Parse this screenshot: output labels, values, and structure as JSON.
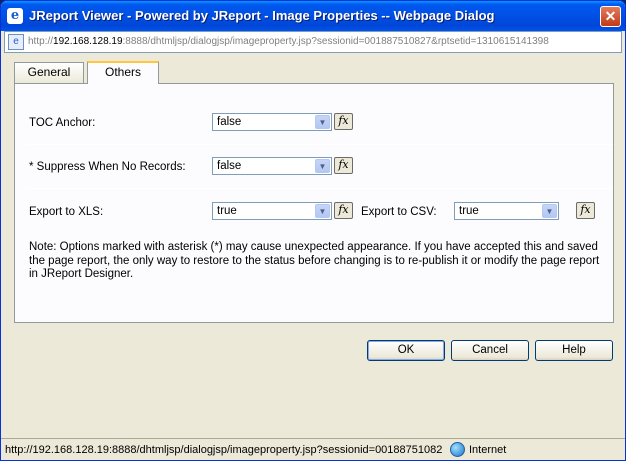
{
  "window": {
    "title": "JReport Viewer - Powered by JReport - Image Properties -- Webpage Dialog",
    "icon": "e",
    "close": "✕"
  },
  "address": {
    "prefix": "http://",
    "host": "192.168.128.19",
    "rest": ":8888/dhtmljsp/dialogjsp/imageproperty.jsp?sessionid=001887510827&rptsetid=1310615141398"
  },
  "tabs": [
    {
      "label": "General"
    },
    {
      "label": "Others"
    }
  ],
  "form": {
    "toc_label": "TOC Anchor:",
    "toc_value": "false",
    "suppress_label": "* Suppress When No Records:",
    "suppress_value": "false",
    "xls_label": "Export to XLS:",
    "xls_value": "true",
    "csv_label": "Export to CSV:",
    "csv_value": "true",
    "fx": "fx",
    "arrow": "▼"
  },
  "note": "Note: Options marked with asterisk (*) may cause unexpected appearance. If you have accepted this and saved the page report, the only way to restore to the status before changing is to re-publish it or modify the page report in JReport Designer.",
  "buttons": {
    "ok": "OK",
    "cancel": "Cancel",
    "help": "Help"
  },
  "status": {
    "url": "http://192.168.128.19:8888/dhtmljsp/dialogjsp/imageproperty.jsp?sessionid=00188751082",
    "zone": "Internet"
  }
}
